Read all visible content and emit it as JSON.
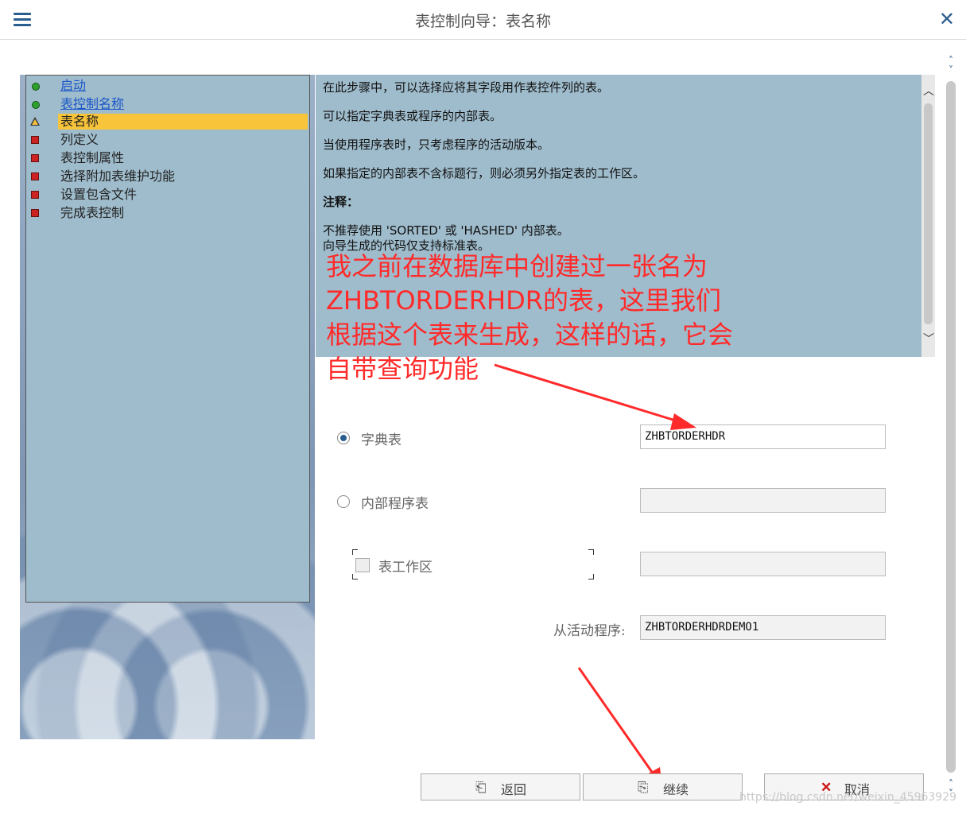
{
  "header": {
    "title": "表控制向导：表名称"
  },
  "nav": {
    "items": [
      {
        "label": "启动",
        "state": "done"
      },
      {
        "label": "表控制名称",
        "state": "done"
      },
      {
        "label": "表名称",
        "state": "current"
      },
      {
        "label": "列定义",
        "state": "pending"
      },
      {
        "label": "表控制属性",
        "state": "pending"
      },
      {
        "label": "选择附加表维护功能",
        "state": "pending"
      },
      {
        "label": "设置包含文件",
        "state": "pending"
      },
      {
        "label": "完成表控制",
        "state": "pending"
      }
    ]
  },
  "info": {
    "p1": "在此步骤中，可以选择应将其字段用作表控件列的表。",
    "p2": "可以指定字典表或程序的内部表。",
    "p3": "当使用程序表时，只考虑程序的活动版本。",
    "p4": "如果指定的内部表不含标题行，则必须另外指定表的工作区。",
    "note_title": "注释：",
    "note1": "不推荐使用 'SORTED' 或 'HASHED' 内部表。",
    "note2": "向导生成的代码仅支持标准表。"
  },
  "annotation": {
    "line1": "我之前在数据库中创建过一张名为",
    "line2": "ZHBTORDERHDR的表，这里我们",
    "line3": "根据这个表来生成，这样的话，它会",
    "line4": "自带查询功能"
  },
  "form": {
    "dict_table_label": "字典表",
    "dict_table_value": "ZHBTORDERHDR",
    "internal_table_label": "内部程序表",
    "internal_table_value": "",
    "workarea_label": "表工作区",
    "workarea_value": "",
    "from_program_label": "从活动程序:",
    "from_program_value": "ZHBTORDERHDRDEMO1"
  },
  "buttons": {
    "back": "返回",
    "continue": "继续",
    "cancel": "取消"
  },
  "watermark": "https://blog.csdn.net/weixin_45963929",
  "colors": {
    "accent": "#2a5d8f",
    "panel": "#9fbccc",
    "highlight": "#f7c43a",
    "annotation": "#ff2a2a"
  }
}
